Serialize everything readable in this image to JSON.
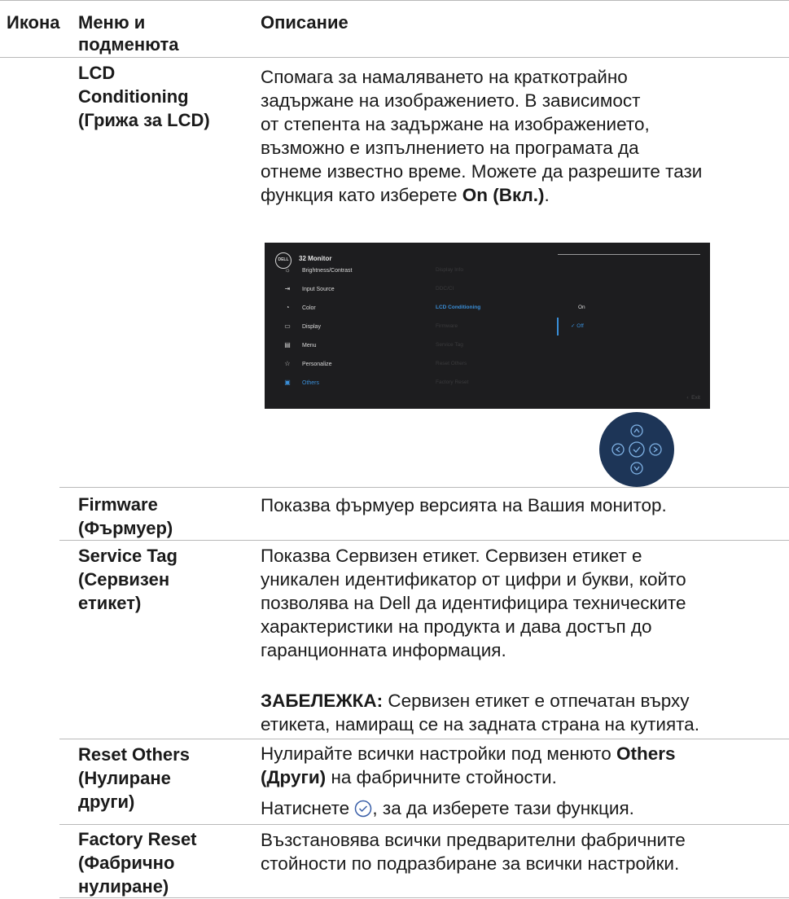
{
  "header": {
    "col_icon": "Икона",
    "col_menu_line1": "Меню и",
    "col_menu_line2": "подменюта",
    "col_desc": "Описание"
  },
  "rows": {
    "lcd": {
      "name_1": "LCD",
      "name_2": "Conditioning",
      "name_3": "(Грижа за LCD)",
      "desc_1": "Спомага за намаляването на краткотрайно",
      "desc_2": "задържане на изображението. В зависимост",
      "desc_3": "от степента на задържане на изображението,",
      "desc_4": "възможно е изпълнението на програмата да",
      "desc_5": "отнеме известно време. Можете да разрешите тази",
      "desc_6a": "функция като изберете ",
      "desc_6b": "On (Вкл.)",
      "desc_6c": "."
    },
    "firmware": {
      "name_1": "Firmware",
      "name_2": "(Фърмуер)",
      "desc_1": "Показва фърмуер версията на Вашия монитор."
    },
    "service_tag": {
      "name_1": "Service Tag",
      "name_2": "(Сервизен",
      "name_3": "етикет)",
      "desc_1": "Показва Сервизен етикет. Сервизен етикет е",
      "desc_2": "уникален идентификатор от цифри и букви, който",
      "desc_3": "позволява на Dell да идентифицира техническите",
      "desc_4": "характеристики на продукта и дава достъп до",
      "desc_5": "гаранционната информация.",
      "note_label": "ЗАБЕЛЕЖКА:",
      "note_1": " Сервизен етикет е отпечатан върху",
      "note_2": "етикета, намиращ се на задната страна на кутията."
    },
    "reset_others": {
      "name_1": "Reset Others",
      "name_2": "(Нулиране",
      "name_3": "други)",
      "desc_1a": "Нулирайте всички настройки под менюто ",
      "desc_1b": "Others",
      "desc_2a": "(Други)",
      "desc_2b": " на фабричните стойности.",
      "press_a": "Натиснете ",
      "press_b": ", за да изберете тази функция."
    },
    "factory_reset": {
      "name_1": "Factory Reset",
      "name_2": "(Фабрично",
      "name_3": "нулиране)",
      "desc_1": "Възстановява всички предварителни фабричните",
      "desc_2": "стойности по подразбиране за всички настройки."
    }
  },
  "osd": {
    "logo": "DELL",
    "title": "32 Monitor",
    "menu": [
      {
        "icon": "sun-icon",
        "label": "Brightness/Contrast"
      },
      {
        "icon": "input-icon",
        "label": "Input Source"
      },
      {
        "icon": "palette-icon",
        "label": "Color"
      },
      {
        "icon": "display-icon",
        "label": "Display"
      },
      {
        "icon": "menu-icon",
        "label": "Menu"
      },
      {
        "icon": "star-icon",
        "label": "Personalize"
      },
      {
        "icon": "others-icon",
        "label": "Others"
      }
    ],
    "submenu": [
      "Display Info",
      "DDC/CI",
      "LCD Conditioning",
      "Firmware",
      "Service Tag",
      "Reset Others",
      "Factory Reset"
    ],
    "options": [
      "On",
      "Off"
    ],
    "exit": "Exit",
    "accent": "#3a8fd9",
    "background": "#1d1d1f"
  }
}
